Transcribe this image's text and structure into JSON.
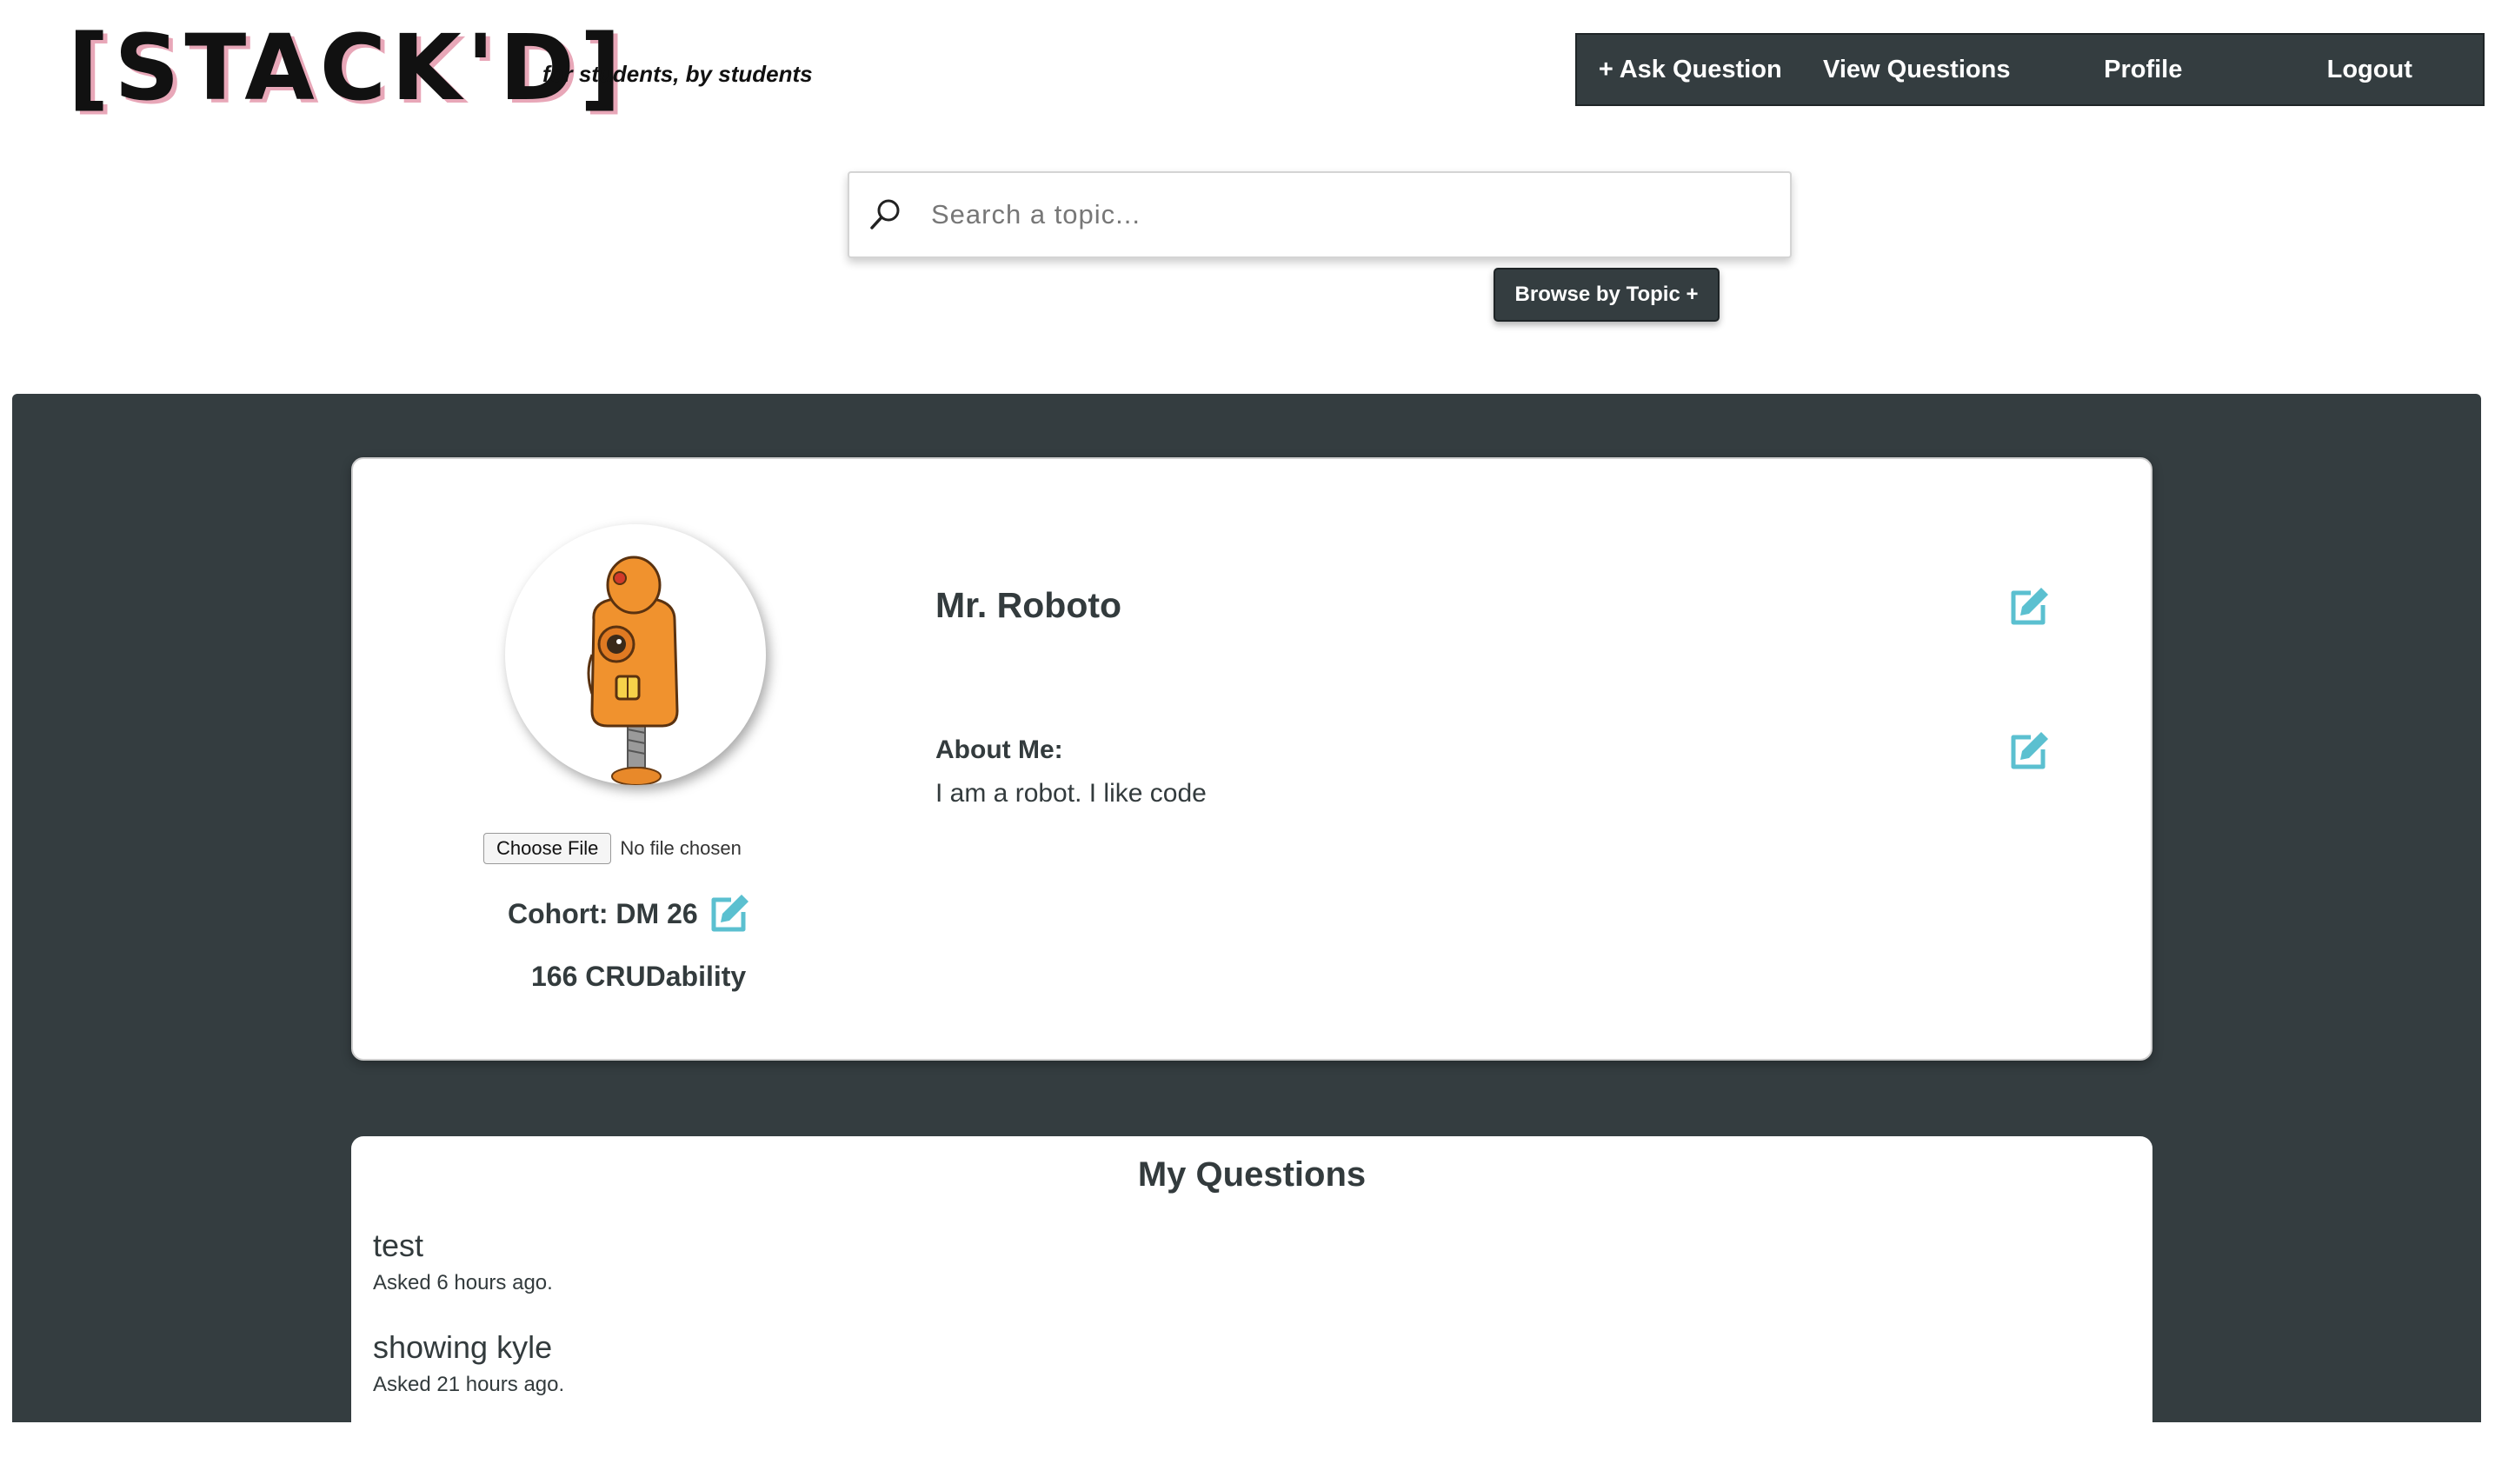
{
  "header": {
    "logo": "[STACK'D]",
    "tagline": "for students, by students"
  },
  "nav": {
    "items": [
      {
        "label": "+ Ask Question"
      },
      {
        "label": "View Questions"
      },
      {
        "label": "Profile"
      },
      {
        "label": "Logout"
      }
    ]
  },
  "search": {
    "placeholder": "Search a topic...",
    "icon": "search-icon",
    "browse_label": "Browse by Topic +"
  },
  "profile": {
    "name": "Mr. Roboto",
    "about_label": "About Me:",
    "about_text": "I am a robot. I like code",
    "choose_file_label": "Choose File",
    "no_file_text": "No file chosen",
    "cohort": "Cohort: DM 26",
    "crudability": "166 CRUDability",
    "edit_icon": "edit-icon"
  },
  "questions": {
    "title": "My Questions",
    "items": [
      {
        "title": "test",
        "time": "Asked 6 hours ago."
      },
      {
        "title": "showing kyle",
        "time": "Asked 21 hours ago."
      }
    ]
  },
  "colors": {
    "panel": "#343d40",
    "accent": "#5bc0d0",
    "text": "#333b3d",
    "logo_shadow": "#e8a7b8"
  }
}
